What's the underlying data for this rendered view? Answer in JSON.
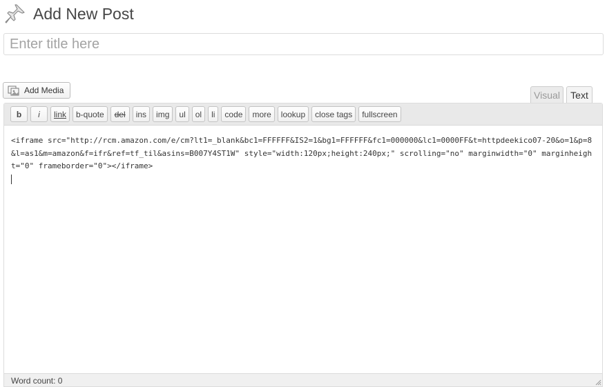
{
  "header": {
    "title": "Add New Post",
    "icon": "pushpin-icon"
  },
  "title_input": {
    "placeholder": "Enter title here",
    "value": ""
  },
  "toolbar": {
    "add_media_label": "Add Media"
  },
  "tabs": [
    {
      "label": "Visual",
      "active": false
    },
    {
      "label": "Text",
      "active": true
    }
  ],
  "quicktags": [
    "b",
    "i",
    "link",
    "b-quote",
    "del",
    "ins",
    "img",
    "ul",
    "ol",
    "li",
    "code",
    "more",
    "lookup",
    "close tags",
    "fullscreen"
  ],
  "editor": {
    "content": "<iframe src=\"http://rcm.amazon.com/e/cm?lt1=_blank&bc1=FFFFFF&IS2=1&bg1=FFFFFF&fc1=000000&lc1=0000FF&t=httpdeekico07-20&o=1&p=8&l=as1&m=amazon&f=ifr&ref=tf_til&asins=B007Y4ST1W\" style=\"width:120px;height:240px;\" scrolling=\"no\" marginwidth=\"0\" marginheight=\"0\" frameborder=\"0\"></iframe>"
  },
  "status": {
    "word_count": "Word count: 0"
  },
  "colors": {
    "toolbar_bg": "#e9e9e9",
    "border": "#dcdcdc",
    "placeholder": "#a3a3a3"
  }
}
